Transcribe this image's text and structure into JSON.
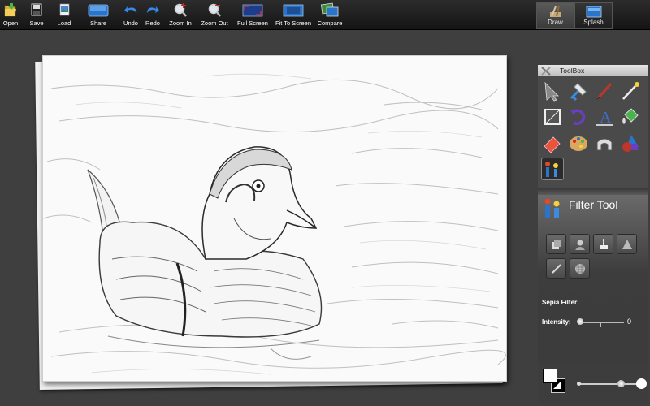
{
  "toolbar": {
    "open": "Open",
    "save": "Save",
    "load": "Load",
    "share": "Share",
    "undo": "Undo",
    "redo": "Redo",
    "zoom_in": "Zoom In",
    "zoom_out": "Zoom Out",
    "full_screen": "Full Screen",
    "fit_to_screen": "Fit To Screen",
    "compare": "Compare"
  },
  "modes": {
    "draw": "Draw",
    "splash": "Splash"
  },
  "toolbox": {
    "title": "ToolBox",
    "tools": [
      "pointer-tool",
      "crop-tool",
      "brush-tool",
      "magic-wand-tool",
      "frame-tool",
      "rotate-tool",
      "text-tool",
      "paint-bucket-tool",
      "eraser-tool",
      "palette-tool",
      "clone-tool",
      "shapes-tool",
      "filter-tool"
    ]
  },
  "filter": {
    "title": "Filter Tool",
    "sepia_label": "Sepia Filter:",
    "intensity_label": "Intensity:",
    "intensity_value": "0"
  },
  "colors": {
    "foreground": "#ffffff",
    "background": "#000000",
    "accent": "#2a74c9"
  }
}
